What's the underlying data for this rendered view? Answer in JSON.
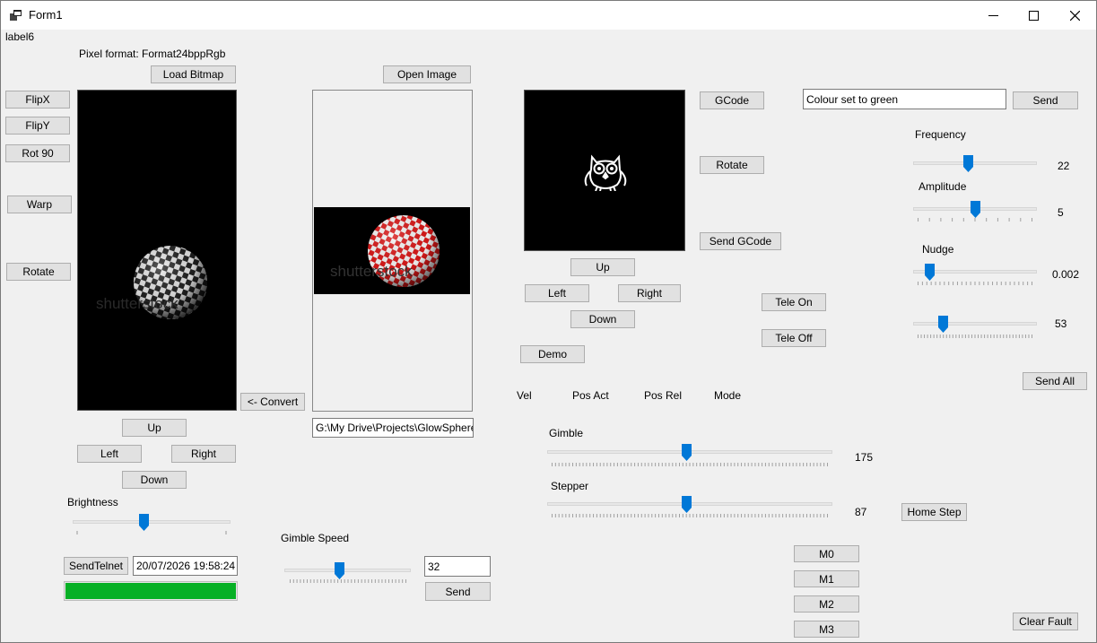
{
  "window": {
    "title": "Form1"
  },
  "labels": {
    "label6": "label6",
    "pixel_format": "Pixel format: Format24bppRgb",
    "brightness": "Brightness",
    "gimble_speed": "Gimble Speed",
    "vel": "Vel",
    "pos_act": "Pos Act",
    "pos_rel": "Pos Rel",
    "mode": "Mode",
    "gimble": "Gimble",
    "stepper": "Stepper",
    "frequency": "Frequency",
    "amplitude": "Amplitude",
    "nudge": "Nudge"
  },
  "buttons": {
    "load_bitmap": "Load Bitmap",
    "open_image": "Open Image",
    "flipx": "FlipX",
    "flipy": "FlipY",
    "rot90": "Rot 90",
    "warp": "Warp",
    "rotate_left": "Rotate",
    "convert": "<- Convert",
    "up1": "Up",
    "left1": "Left",
    "right1": "Right",
    "down1": "Down",
    "sendtelnet": "SendTelnet",
    "send_speed": "Send",
    "gcode": "GCode",
    "rotate_gcode": "Rotate",
    "send_gcode": "Send GCode",
    "up2": "Up",
    "left2": "Left",
    "right2": "Right",
    "down2": "Down",
    "demo": "Demo",
    "tele_on": "Tele On",
    "tele_off": "Tele Off",
    "send_colour": "Send",
    "send_all": "Send All",
    "home_step": "Home Step",
    "m0": "M0",
    "m1": "M1",
    "m2": "M2",
    "m3": "M3",
    "clear_fault": "Clear Fault"
  },
  "inputs": {
    "datetime": "20/07/2026 19:58:24",
    "speed_value": "32",
    "path": "G:\\My Drive\\Projects\\GlowSphere",
    "colour_status": "Colour set to green"
  },
  "sliders": {
    "brightness": {
      "fraction": 0.45
    },
    "gimble_speed": {
      "fraction": 0.43
    },
    "gimble": {
      "fraction": 0.49,
      "value": "175"
    },
    "stepper": {
      "fraction": 0.49,
      "value": "87"
    },
    "frequency": {
      "fraction": 0.44,
      "value": "22"
    },
    "amplitude": {
      "fraction": 0.5,
      "value": "5"
    },
    "nudge": {
      "fraction": 0.1,
      "value": "0.002"
    },
    "extra": {
      "fraction": 0.22,
      "value": "53"
    }
  },
  "progress": {
    "fraction": 1.0,
    "color": "#06b025"
  },
  "colors": {
    "accent": "#0078d7",
    "window_bg": "#f0f0f0",
    "button_bg": "#e1e1e1"
  },
  "icons": [
    "form-icon",
    "minimize-icon",
    "maximize-icon",
    "close-icon",
    "owl-icon"
  ]
}
